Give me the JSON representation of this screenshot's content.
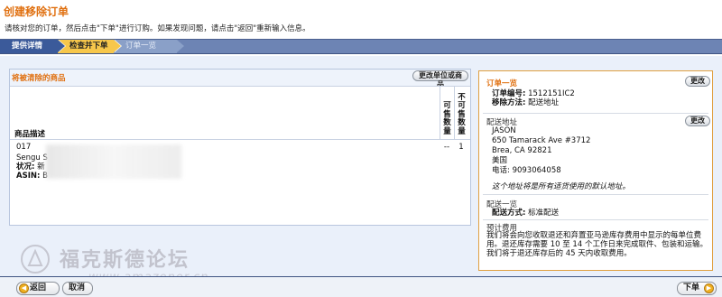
{
  "header": {
    "title": "创建移除订单",
    "subtitle": "请核对您的订单，然后点击\"下单\"进行订购。如果发现问题，请点击\"返回\"重新输入信息。"
  },
  "wizard": {
    "steps": [
      {
        "label": "提供详情",
        "state": "done"
      },
      {
        "label": "检查并下单",
        "state": "current"
      },
      {
        "label": "订单一览",
        "state": "pending"
      }
    ]
  },
  "products": {
    "section_title": "将被清除的商品",
    "change_units_label": "更改单位或商品",
    "columns": {
      "description": "商品描述",
      "sellable": "可售数量",
      "unsellable": "不可售数量"
    },
    "rows": [
      {
        "id_line": "017",
        "name_line": "Sengu S",
        "condition_label": "状况:",
        "condition_value": "新",
        "asin_label": "ASIN:",
        "asin_value": "B",
        "sellable": "--",
        "unsellable": "1"
      }
    ]
  },
  "summary": {
    "title": "订单一览",
    "edit_label": "更改",
    "order_no_label": "订单编号:",
    "order_no_value": "1512151IC2",
    "removal_method_label": "移除方法:",
    "removal_method_value": "配送地址",
    "address": {
      "title": "配送地址",
      "edit_label": "更改",
      "name": "JASON",
      "street": "650 Tamarack Ave #3712",
      "city_line": "Brea,  CA  92821",
      "country": "美国",
      "phone_label": "电话:",
      "phone_value": "9093064058",
      "note": "这个地址将是所有适货使用的默认地址。"
    },
    "shipping": {
      "title": "配送一览",
      "method_label": "配送方式:",
      "method_value": "标准配送"
    },
    "fees": {
      "title": "预计费用",
      "text": "我们将会向您收取退还和弃置亚马逊库存费用中显示的每单位费用。退还库存需要 10 至 14 个工作日来完成取件、包装和运输。我们将于退还库存后的 45 天内收取费用。"
    }
  },
  "footer": {
    "back_label": "返回",
    "cancel_label": "取消",
    "next_label": "下单"
  },
  "watermark": {
    "title": "福克斯德论坛",
    "url": "www.amazoner.cn"
  },
  "colors": {
    "accent": "#e07010",
    "wizard_bar": "#6d84b4",
    "current_step": "#f7c74b",
    "panel_bg": "#eaf0fa"
  }
}
